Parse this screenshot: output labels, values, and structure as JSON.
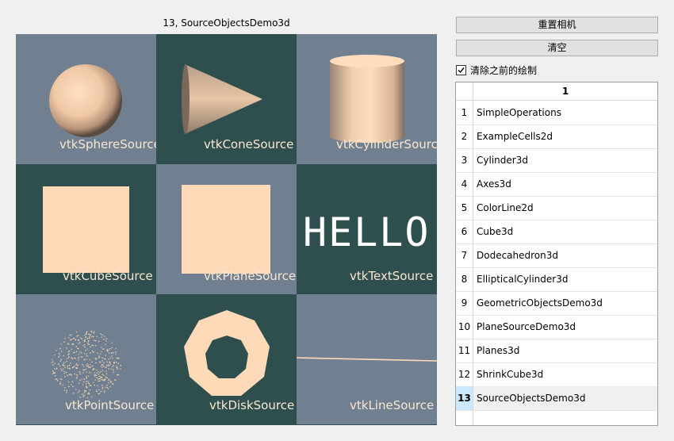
{
  "window": {
    "view_title": "13, SourceObjectsDemo3d"
  },
  "controls": {
    "reset_camera_label": "重置相机",
    "clear_label": "清空",
    "clear_previous_label": "清除之前的绘制",
    "clear_previous_checked": true
  },
  "table": {
    "column_header": "1",
    "rows": [
      {
        "num": "1",
        "name": "SimpleOperations"
      },
      {
        "num": "2",
        "name": "ExampleCells2d"
      },
      {
        "num": "3",
        "name": "Cylinder3d"
      },
      {
        "num": "4",
        "name": "Axes3d"
      },
      {
        "num": "5",
        "name": "ColorLine2d"
      },
      {
        "num": "6",
        "name": "Cube3d"
      },
      {
        "num": "7",
        "name": "Dodecahedron3d"
      },
      {
        "num": "8",
        "name": "EllipticalCylinder3d"
      },
      {
        "num": "9",
        "name": "GeometricObjectsDemo3d"
      },
      {
        "num": "10",
        "name": "PlaneSourceDemo3d"
      },
      {
        "num": "11",
        "name": "Planes3d"
      },
      {
        "num": "12",
        "name": "ShrinkCube3d"
      },
      {
        "num": "13",
        "name": "SourceObjectsDemo3d"
      }
    ],
    "selected_row": "13"
  },
  "render_cells": [
    {
      "label": "vtkSphereSource",
      "background": "#708090"
    },
    {
      "label": "vtkConeSource",
      "background": "#2f4f4f"
    },
    {
      "label": "vtkCylinderSource",
      "background": "#708090"
    },
    {
      "label": "vtkCubeSource",
      "background": "#2f4f4f"
    },
    {
      "label": "vtkPlaneSource",
      "background": "#708090"
    },
    {
      "label": "vtkTextSource",
      "background": "#2f4f4f"
    },
    {
      "label": "vtkPointSource",
      "background": "#708090"
    },
    {
      "label": "vtkDiskSource",
      "background": "#2f4f4f"
    },
    {
      "label": "vtkLineSource",
      "background": "#708090"
    }
  ],
  "text_source_text": "HELLO",
  "colors": {
    "object": "#ffdab9",
    "label": "#fbe7d1",
    "slate": "#708090",
    "dark_slate": "#2f4f4f"
  }
}
